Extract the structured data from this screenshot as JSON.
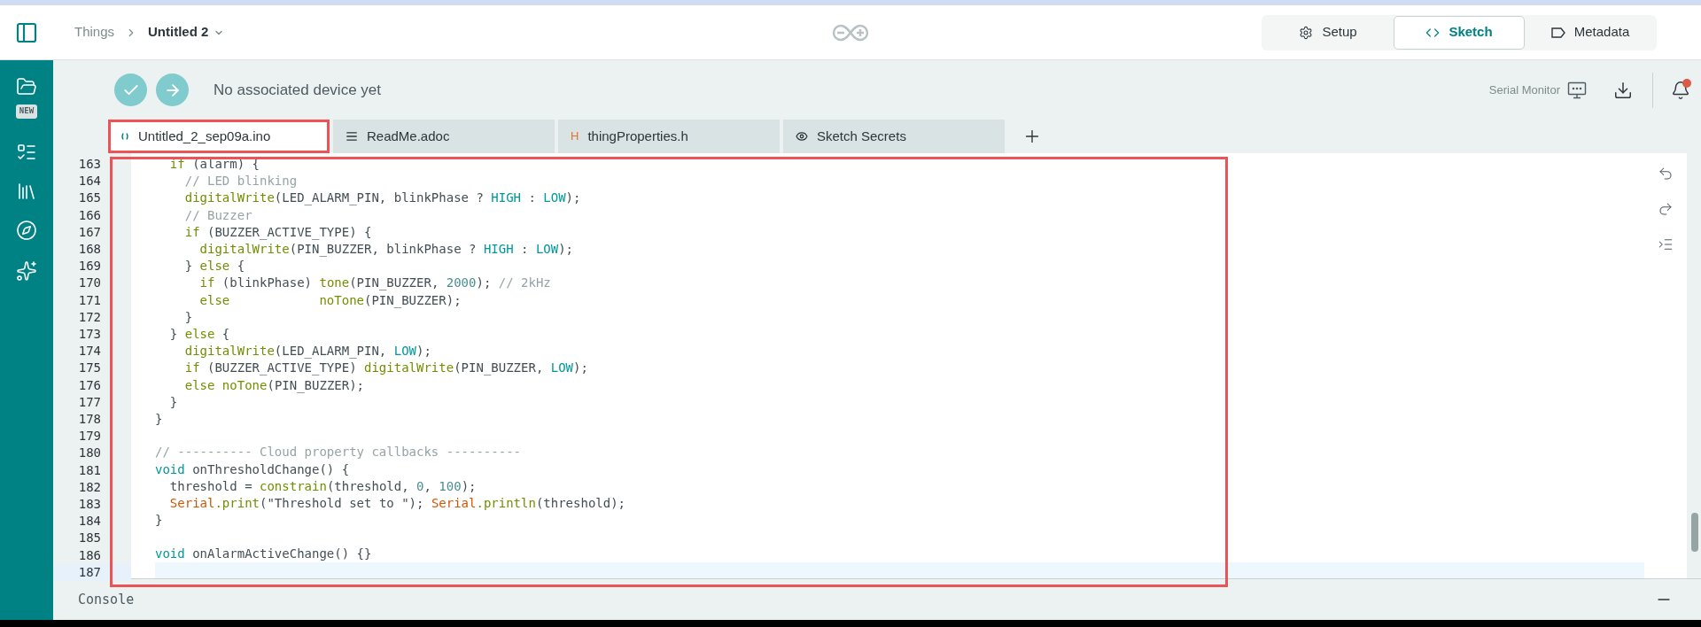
{
  "breadcrumb": {
    "parent": "Things",
    "current": "Untitled 2"
  },
  "views": [
    {
      "label": "Setup",
      "kind": "setup",
      "selected": false
    },
    {
      "label": "Sketch",
      "kind": "sketch",
      "selected": true
    },
    {
      "label": "Metadata",
      "kind": "metadata",
      "selected": false
    }
  ],
  "sidebar": {
    "badge": "NEW"
  },
  "toolbar": {
    "device_status": "No associated device yet",
    "serial_monitor": "Serial Monitor",
    "notification_unread": true
  },
  "tabs": [
    {
      "label": "Untitled_2_sep09a.ino",
      "kind": "code",
      "selected": true,
      "highlighted": true
    },
    {
      "label": "ReadMe.adoc",
      "kind": "text",
      "selected": false,
      "highlighted": false
    },
    {
      "label": "thingProperties.h",
      "kind": "header",
      "icon_text": "H",
      "selected": false,
      "highlighted": false
    },
    {
      "label": "Sketch Secrets",
      "kind": "secret",
      "selected": false,
      "highlighted": false
    }
  ],
  "editor": {
    "highlighted": true,
    "lines": [
      {
        "number": "163",
        "active": false,
        "tokens": [
          {
            "kind": "keyword",
            "text": "  if"
          },
          {
            "kind": "plain",
            "text": " (alarm) {"
          }
        ]
      },
      {
        "number": "164",
        "active": false,
        "tokens": [
          {
            "kind": "comment",
            "text": "    // LED blinking"
          }
        ]
      },
      {
        "number": "165",
        "active": false,
        "tokens": [
          {
            "kind": "keyword",
            "text": "    digitalWrite"
          },
          {
            "kind": "plain",
            "text": "(LED_ALARM_PIN, blinkPhase ? "
          },
          {
            "kind": "constant",
            "text": "HIGH"
          },
          {
            "kind": "plain",
            "text": " : "
          },
          {
            "kind": "constant",
            "text": "LOW"
          },
          {
            "kind": "plain",
            "text": ");"
          }
        ]
      },
      {
        "number": "166",
        "active": false,
        "tokens": [
          {
            "kind": "comment",
            "text": "    // Buzzer"
          }
        ]
      },
      {
        "number": "167",
        "active": false,
        "tokens": [
          {
            "kind": "keyword",
            "text": "    if"
          },
          {
            "kind": "plain",
            "text": " (BUZZER_ACTIVE_TYPE) {"
          }
        ]
      },
      {
        "number": "168",
        "active": false,
        "tokens": [
          {
            "kind": "keyword",
            "text": "      digitalWrite"
          },
          {
            "kind": "plain",
            "text": "(PIN_BUZZER, blinkPhase ? "
          },
          {
            "kind": "constant",
            "text": "HIGH"
          },
          {
            "kind": "plain",
            "text": " : "
          },
          {
            "kind": "constant",
            "text": "LOW"
          },
          {
            "kind": "plain",
            "text": ");"
          }
        ]
      },
      {
        "number": "169",
        "active": false,
        "tokens": [
          {
            "kind": "plain",
            "text": "    } "
          },
          {
            "kind": "keyword",
            "text": "else"
          },
          {
            "kind": "plain",
            "text": " {"
          }
        ]
      },
      {
        "number": "170",
        "active": false,
        "tokens": [
          {
            "kind": "keyword",
            "text": "      if"
          },
          {
            "kind": "plain",
            "text": " (blinkPhase) "
          },
          {
            "kind": "keyword",
            "text": "tone"
          },
          {
            "kind": "plain",
            "text": "(PIN_BUZZER, "
          },
          {
            "kind": "number",
            "text": "2000"
          },
          {
            "kind": "plain",
            "text": "); "
          },
          {
            "kind": "comment",
            "text": "// 2kHz"
          }
        ]
      },
      {
        "number": "171",
        "active": false,
        "tokens": [
          {
            "kind": "keyword",
            "text": "      else"
          },
          {
            "kind": "keyword",
            "text": "            noTone"
          },
          {
            "kind": "plain",
            "text": "(PIN_BUZZER);"
          }
        ]
      },
      {
        "number": "172",
        "active": false,
        "tokens": [
          {
            "kind": "plain",
            "text": "    }"
          }
        ]
      },
      {
        "number": "173",
        "active": false,
        "tokens": [
          {
            "kind": "plain",
            "text": "  } "
          },
          {
            "kind": "keyword",
            "text": "else"
          },
          {
            "kind": "plain",
            "text": " {"
          }
        ]
      },
      {
        "number": "174",
        "active": false,
        "tokens": [
          {
            "kind": "keyword",
            "text": "    digitalWrite"
          },
          {
            "kind": "plain",
            "text": "(LED_ALARM_PIN, "
          },
          {
            "kind": "constant",
            "text": "LOW"
          },
          {
            "kind": "plain",
            "text": ");"
          }
        ]
      },
      {
        "number": "175",
        "active": false,
        "tokens": [
          {
            "kind": "keyword",
            "text": "    if"
          },
          {
            "kind": "plain",
            "text": " (BUZZER_ACTIVE_TYPE) "
          },
          {
            "kind": "keyword",
            "text": "digitalWrite"
          },
          {
            "kind": "plain",
            "text": "(PIN_BUZZER, "
          },
          {
            "kind": "constant",
            "text": "LOW"
          },
          {
            "kind": "plain",
            "text": ");"
          }
        ]
      },
      {
        "number": "176",
        "active": false,
        "tokens": [
          {
            "kind": "keyword",
            "text": "    else"
          },
          {
            "kind": "keyword",
            "text": " noTone"
          },
          {
            "kind": "plain",
            "text": "(PIN_BUZZER);"
          }
        ]
      },
      {
        "number": "177",
        "active": false,
        "tokens": [
          {
            "kind": "plain",
            "text": "  }"
          }
        ]
      },
      {
        "number": "178",
        "active": false,
        "tokens": [
          {
            "kind": "plain",
            "text": "}"
          }
        ]
      },
      {
        "number": "179",
        "active": false
      },
      {
        "number": "180",
        "active": false,
        "tokens": [
          {
            "kind": "comment",
            "text": "// ---------- Cloud property callbacks ----------"
          }
        ]
      },
      {
        "number": "181",
        "active": false,
        "tokens": [
          {
            "kind": "constant",
            "text": "void"
          },
          {
            "kind": "plain",
            "text": " onThresholdChange() {"
          }
        ]
      },
      {
        "number": "182",
        "active": false,
        "tokens": [
          {
            "kind": "plain",
            "text": "  threshold = "
          },
          {
            "kind": "keyword",
            "text": "constrain"
          },
          {
            "kind": "plain",
            "text": "(threshold, "
          },
          {
            "kind": "number",
            "text": "0"
          },
          {
            "kind": "plain",
            "text": ", "
          },
          {
            "kind": "number",
            "text": "100"
          },
          {
            "kind": "plain",
            "text": ");"
          }
        ]
      },
      {
        "number": "183",
        "active": false,
        "tokens": [
          {
            "kind": "class",
            "text": "  Serial"
          },
          {
            "kind": "keyword",
            "text": ".print"
          },
          {
            "kind": "plain",
            "text": "(\"Threshold set to \"); "
          },
          {
            "kind": "class",
            "text": "Serial"
          },
          {
            "kind": "keyword",
            "text": ".println"
          },
          {
            "kind": "plain",
            "text": "(threshold);"
          }
        ]
      },
      {
        "number": "184",
        "active": false,
        "tokens": [
          {
            "kind": "plain",
            "text": "}"
          }
        ]
      },
      {
        "number": "185",
        "active": false
      },
      {
        "number": "186",
        "active": false,
        "tokens": [
          {
            "kind": "constant",
            "text": "void"
          },
          {
            "kind": "plain",
            "text": " onAlarmActiveChange() {}"
          }
        ]
      },
      {
        "number": "187",
        "active": true
      }
    ]
  },
  "console": {
    "title": "Console"
  }
}
